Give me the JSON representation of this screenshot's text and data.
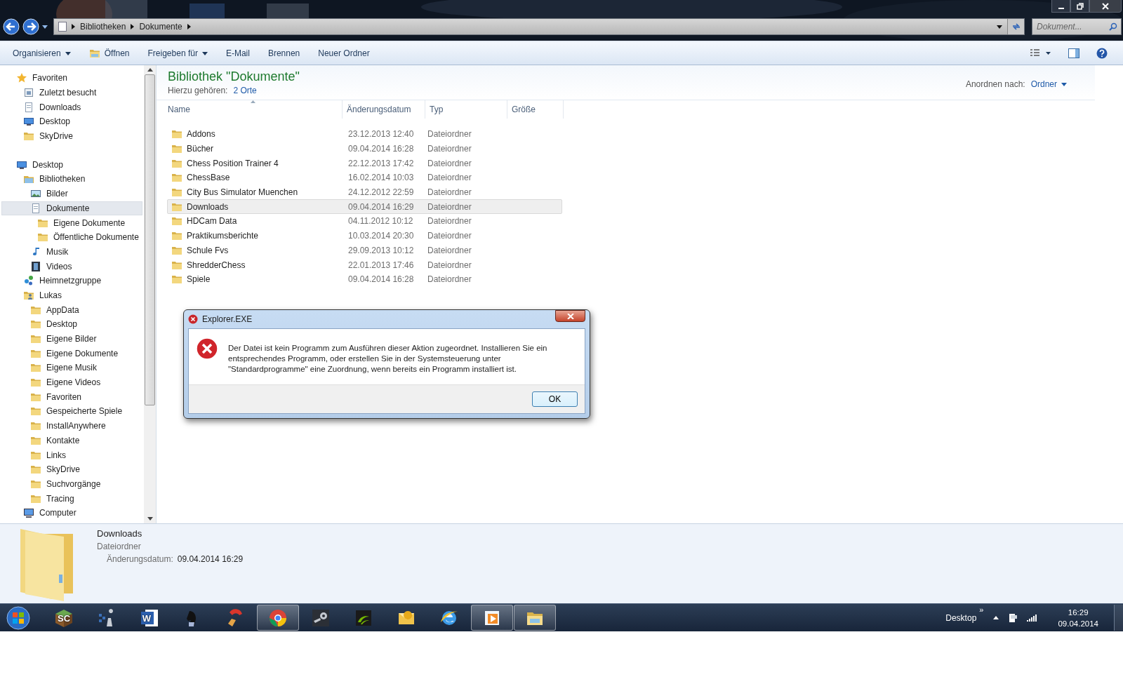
{
  "address": {
    "crumbs": [
      "Bibliotheken",
      "Dokumente"
    ],
    "search_placeholder": "Dokument..."
  },
  "toolbar": [
    {
      "label": "Organisieren",
      "kind": "menu"
    },
    {
      "label": "Öffnen",
      "kind": "icon"
    },
    {
      "label": "Freigeben für",
      "kind": "menu"
    },
    {
      "label": "E-Mail",
      "kind": "plain"
    },
    {
      "label": "Brennen",
      "kind": "plain"
    },
    {
      "label": "Neuer Ordner",
      "kind": "plain"
    }
  ],
  "nav": [
    {
      "label": "Favoriten",
      "kind": "star",
      "selected": false,
      "children": [
        {
          "label": "Zuletzt besucht",
          "kind": "recent",
          "selected": false
        },
        {
          "label": "Downloads",
          "kind": "doc",
          "selected": false
        },
        {
          "label": "Desktop",
          "kind": "desktop",
          "selected": false
        },
        {
          "label": "SkyDrive",
          "kind": "folder",
          "selected": false
        }
      ]
    },
    {
      "label": "Desktop",
      "kind": "desktop",
      "selected": false,
      "children": [
        {
          "label": "Bibliotheken",
          "kind": "library",
          "selected": false,
          "children": [
            {
              "label": "Bilder",
              "kind": "pictures",
              "selected": false
            },
            {
              "label": "Dokumente",
              "kind": "doc",
              "selected": true,
              "children": [
                {
                  "label": "Eigene Dokumente",
                  "kind": "folder",
                  "selected": false
                },
                {
                  "label": "Öffentliche Dokumente",
                  "kind": "folder",
                  "selected": false
                }
              ]
            },
            {
              "label": "Musik",
              "kind": "music",
              "selected": false
            },
            {
              "label": "Videos",
              "kind": "video",
              "selected": false
            }
          ]
        },
        {
          "label": "Heimnetzgruppe",
          "kind": "network",
          "selected": false
        },
        {
          "label": "Lukas",
          "kind": "user",
          "selected": false,
          "children": [
            {
              "label": "AppData",
              "kind": "folder",
              "selected": false
            },
            {
              "label": "Desktop",
              "kind": "folder",
              "selected": false
            },
            {
              "label": "Eigene Bilder",
              "kind": "folder",
              "selected": false
            },
            {
              "label": "Eigene Dokumente",
              "kind": "folder",
              "selected": false
            },
            {
              "label": "Eigene Musik",
              "kind": "folder",
              "selected": false
            },
            {
              "label": "Eigene Videos",
              "kind": "folder",
              "selected": false
            },
            {
              "label": "Favoriten",
              "kind": "folder",
              "selected": false
            },
            {
              "label": "Gespeicherte Spiele",
              "kind": "folder",
              "selected": false
            },
            {
              "label": "InstallAnywhere",
              "kind": "folder",
              "selected": false
            },
            {
              "label": "Kontakte",
              "kind": "folder",
              "selected": false
            },
            {
              "label": "Links",
              "kind": "folder",
              "selected": false
            },
            {
              "label": "SkyDrive",
              "kind": "folder",
              "selected": false
            },
            {
              "label": "Suchvorgänge",
              "kind": "folder",
              "selected": false
            },
            {
              "label": "Tracing",
              "kind": "folder",
              "selected": false
            }
          ]
        },
        {
          "label": "Computer",
          "kind": "computer",
          "selected": false
        }
      ]
    }
  ],
  "library": {
    "title": "Bibliothek \"Dokumente\"",
    "includes_label": "Hierzu gehören:",
    "includes_link": "2 Orte",
    "arrange_label": "Anordnen nach:",
    "arrange_value": "Ordner"
  },
  "table": {
    "columns": [
      "Name",
      "Änderungsdatum",
      "Typ",
      "Größe"
    ],
    "rows": [
      {
        "name": "Addons",
        "date": "23.12.2013 12:40",
        "type": "Dateiordner",
        "selected": false
      },
      {
        "name": "Bücher",
        "date": "09.04.2014 16:28",
        "type": "Dateiordner",
        "selected": false
      },
      {
        "name": "Chess Position Trainer 4",
        "date": "22.12.2013 17:42",
        "type": "Dateiordner",
        "selected": false
      },
      {
        "name": "ChessBase",
        "date": "16.02.2014 10:03",
        "type": "Dateiordner",
        "selected": false
      },
      {
        "name": "City Bus Simulator Muenchen",
        "date": "24.12.2012 22:59",
        "type": "Dateiordner",
        "selected": false
      },
      {
        "name": "Downloads",
        "date": "09.04.2014 16:29",
        "type": "Dateiordner",
        "selected": true
      },
      {
        "name": "HDCam Data",
        "date": "04.11.2012 10:12",
        "type": "Dateiordner",
        "selected": false
      },
      {
        "name": "Praktikumsberichte",
        "date": "10.03.2014 20:30",
        "type": "Dateiordner",
        "selected": false
      },
      {
        "name": "Schule Fvs",
        "date": "29.09.2013 10:12",
        "type": "Dateiordner",
        "selected": false
      },
      {
        "name": "ShredderChess",
        "date": "22.01.2013 17:46",
        "type": "Dateiordner",
        "selected": false
      },
      {
        "name": "Spiele",
        "date": "09.04.2014 16:28",
        "type": "Dateiordner",
        "selected": false
      }
    ]
  },
  "details": {
    "name": "Downloads",
    "type": "Dateiordner",
    "date_label": "Änderungsdatum:",
    "date_value": "09.04.2014 16:29"
  },
  "dialog": {
    "title": "Explorer.EXE",
    "message": "Der Datei ist kein Programm zum Ausführen dieser Aktion zugeordnet. Installieren Sie ein entsprechendes Programm, oder erstellen Sie in der Systemsteuerung unter \"Standardprogramme\" eine Zuordnung, wenn bereits ein Programm installiert ist.",
    "button": "OK"
  },
  "taskbar": {
    "apps": [
      {
        "kind": "sc",
        "label": "SC",
        "open": false
      },
      {
        "kind": "chess",
        "open": false
      },
      {
        "kind": "word",
        "label": "W",
        "open": false
      },
      {
        "kind": "horse",
        "open": false
      },
      {
        "kind": "broom",
        "open": false
      },
      {
        "kind": "chrome",
        "open": true
      },
      {
        "kind": "steam",
        "open": false
      },
      {
        "kind": "nvidia",
        "open": false
      },
      {
        "kind": "mail",
        "open": false
      },
      {
        "kind": "ie",
        "open": false
      },
      {
        "kind": "media",
        "open": true
      },
      {
        "kind": "explorer",
        "open": true
      }
    ],
    "toolbar_label": "Desktop",
    "toolbar_more": "»",
    "time": "16:29",
    "date": "09.04.2014"
  }
}
